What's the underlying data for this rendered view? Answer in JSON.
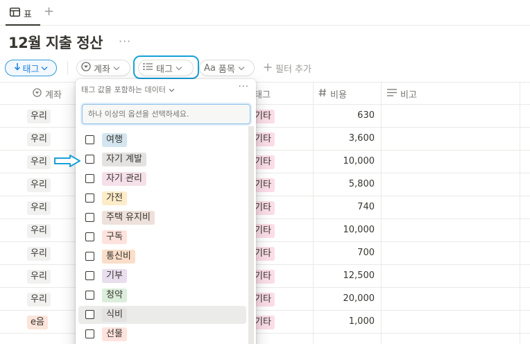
{
  "tabs": {
    "active_label": "표",
    "add_symbol": "+"
  },
  "page": {
    "title": "12월 지출 정산",
    "more": "···"
  },
  "filters": {
    "sort_label": "태그",
    "account_label": "계좌",
    "tag_label": "태그",
    "item_prefix": "Aa",
    "item_label": "품목",
    "add_filter_label": "필터 추가"
  },
  "columns": {
    "account": "계좌",
    "tag": "태그",
    "cost": "비용",
    "memo": "비고"
  },
  "rows": [
    {
      "account": "우리",
      "tag": "기타",
      "cost": "630"
    },
    {
      "account": "우리",
      "tag": "기타",
      "cost": "3,600"
    },
    {
      "account": "우리",
      "tag": "기타",
      "cost": "10,000"
    },
    {
      "account": "우리",
      "tag": "기타",
      "cost": "5,800"
    },
    {
      "account": "우리",
      "tag": "기타",
      "cost": "740"
    },
    {
      "account": "우리",
      "tag": "기타",
      "cost": "10,000"
    },
    {
      "account": "우리",
      "tag": "기타",
      "cost": "700"
    },
    {
      "account": "우리",
      "tag": "기타",
      "cost": "12,500"
    },
    {
      "account": "우리",
      "tag": "기타",
      "cost": "20,000"
    },
    {
      "account": "e음",
      "tag": "기타",
      "cost": "1,000"
    }
  ],
  "dropdown": {
    "heading": "태그 값을 포함하는 데이터",
    "more": "···",
    "search_placeholder": "하나 이상의 옵션을 선택하세요.",
    "options": [
      {
        "label": "여행",
        "color": "#d3e5ef"
      },
      {
        "label": "자기 계발",
        "color": "#e3e2e0"
      },
      {
        "label": "자기 관리",
        "color": "#f5e0e9"
      },
      {
        "label": "가전",
        "color": "#fdecc8"
      },
      {
        "label": "주택 유지비",
        "color": "#eee0da"
      },
      {
        "label": "구독",
        "color": "#ffe2dd"
      },
      {
        "label": "통신비",
        "color": "#fadec9"
      },
      {
        "label": "기부",
        "color": "#e8deee"
      },
      {
        "label": "청약",
        "color": "#dbeddb"
      },
      {
        "label": "식비",
        "color": "#e3e2e0"
      },
      {
        "label": "선물",
        "color": "#ffe2dd"
      }
    ]
  },
  "colors": {
    "accent": "#2383e2",
    "highlight": "#1aa0d8"
  }
}
